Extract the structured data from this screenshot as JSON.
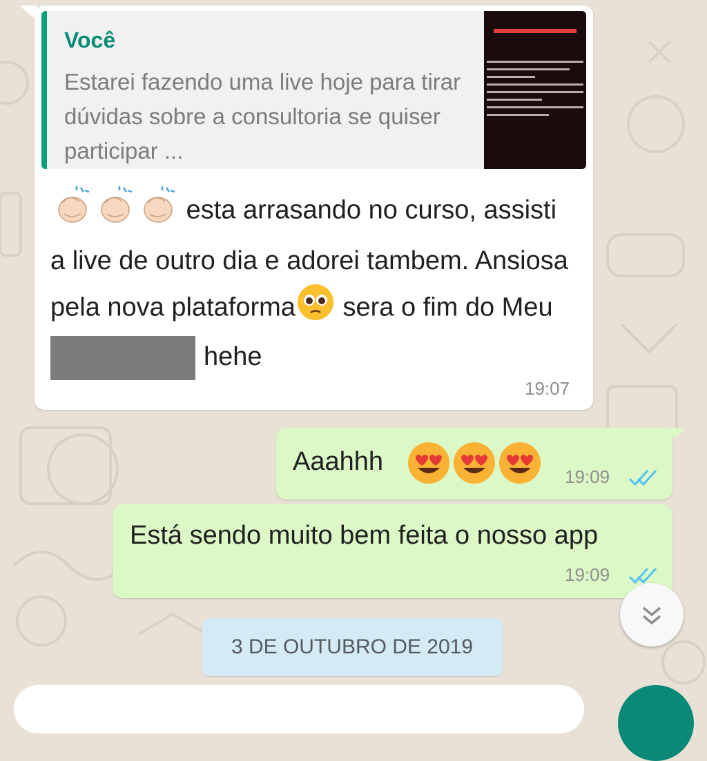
{
  "quoted": {
    "author": "Você",
    "text": "Estarei fazendo uma live hoje para tirar dúvidas sobre a consultoria se quiser participar ..."
  },
  "incoming": {
    "emoji_prefix": [
      "clapping-hands-emoji",
      "clapping-hands-emoji",
      "clapping-hands-emoji"
    ],
    "text_part1": "esta arrasando no curso, assisti a live de outro dia e adorei tambem. Ansiosa pela nova plataforma",
    "emoji_mid": "pleading-face-emoji",
    "text_part2": "sera o fim do Meu",
    "text_part3": "hehe",
    "time": "19:07"
  },
  "outgoing": [
    {
      "text": "Aaahhh",
      "emojis": [
        "heart-eyes-emoji",
        "heart-eyes-emoji",
        "heart-eyes-emoji"
      ],
      "time": "19:09",
      "status": "read"
    },
    {
      "text": "Está sendo muito bem feita o nosso app",
      "time": "19:09",
      "status": "read"
    }
  ],
  "date_separator": "3 DE OUTUBRO DE 2019",
  "colors": {
    "incoming_bubble": "#ffffff",
    "outgoing_bubble": "#dcf8c6",
    "accent": "#0a8a76",
    "read_ticks": "#4fc3f7",
    "date_chip": "#d4eaf4"
  }
}
